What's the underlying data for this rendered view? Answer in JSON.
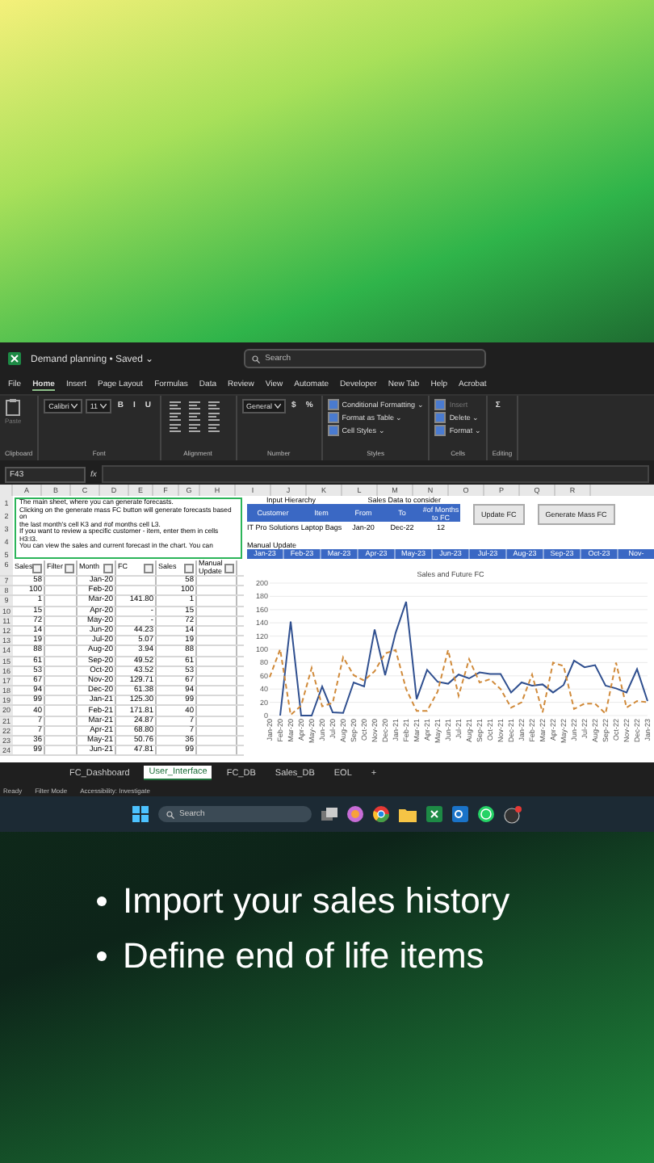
{
  "titlebar": {
    "title": "Demand planning • Saved ⌄",
    "search": {
      "placeholder": "Search"
    }
  },
  "menu": [
    {
      "label": "File",
      "selected": false
    },
    {
      "label": "Home",
      "selected": true
    },
    {
      "label": "Insert",
      "selected": false
    },
    {
      "label": "Page Layout",
      "selected": false
    },
    {
      "label": "Formulas",
      "selected": false
    },
    {
      "label": "Data",
      "selected": false
    },
    {
      "label": "Review",
      "selected": false
    },
    {
      "label": "View",
      "selected": false
    },
    {
      "label": "Automate",
      "selected": false
    },
    {
      "label": "Developer",
      "selected": false
    },
    {
      "label": "New Tab",
      "selected": false
    },
    {
      "label": "Help",
      "selected": false
    },
    {
      "label": "Acrobat",
      "selected": false
    }
  ],
  "ribbon": [
    {
      "label": "Clipboard",
      "items": [
        {
          "kind": "paste",
          "text": "Paste",
          "disabled": true
        }
      ]
    },
    {
      "label": "Font",
      "items": [
        {
          "kind": "field",
          "text": "Calibri"
        },
        {
          "kind": "field",
          "text": "11"
        },
        {
          "kind": "glyph",
          "text": "B"
        },
        {
          "kind": "glyph",
          "text": "I"
        },
        {
          "kind": "glyph",
          "text": "U"
        }
      ]
    },
    {
      "label": "Alignment",
      "items": [
        {
          "kind": "align"
        }
      ]
    },
    {
      "label": "Number",
      "items": [
        {
          "kind": "field",
          "text": "General"
        },
        {
          "kind": "glyph",
          "text": "$"
        },
        {
          "kind": "glyph",
          "text": "%"
        }
      ]
    },
    {
      "label": "Styles",
      "items": [
        {
          "kind": "row",
          "text": "Conditional Formatting ⌄",
          "disabled": false
        },
        {
          "kind": "row",
          "text": "Format as Table ⌄",
          "disabled": false
        },
        {
          "kind": "row",
          "text": "Cell Styles ⌄",
          "disabled": false
        }
      ]
    },
    {
      "label": "Cells",
      "items": [
        {
          "kind": "row",
          "text": "Insert",
          "disabled": true
        },
        {
          "kind": "row",
          "text": "Delete ⌄",
          "disabled": false
        },
        {
          "kind": "row",
          "text": "Format ⌄",
          "disabled": false
        }
      ]
    },
    {
      "label": "Editing",
      "items": [
        {
          "kind": "glyph",
          "text": "Σ"
        }
      ]
    }
  ],
  "formula_bar": {
    "name_box": "F43",
    "fx": "fx"
  },
  "columns": [
    "A",
    "B",
    "C",
    "D",
    "E",
    "F",
    "G",
    "H",
    "I",
    "J",
    "K",
    "L",
    "M",
    "N",
    "O",
    "P",
    "Q",
    "R"
  ],
  "note": {
    "lines": [
      "The main sheet, where you can generate forecasts.",
      "Clicking on the generate mass FC button will generate forecasts based on",
      "the last month's cell K3 and #of months cell L3.",
      "If you want to review a specific customer - item, enter them in cells H3:I3.",
      "You can view the sales and current forecast in the chart. You can"
    ],
    "row_numbers": [
      "1",
      "2",
      "3",
      "4",
      "5"
    ]
  },
  "table": {
    "header_row": "6",
    "headers": [
      "Sales",
      "Filter",
      "Month",
      "FC",
      "Sales",
      "Manual Update"
    ],
    "rows": [
      {
        "row": "7",
        "sales": "58",
        "month": "Jan-20",
        "fc": "",
        "sales2": "58"
      },
      {
        "row": "8",
        "sales": "100",
        "month": "Feb-20",
        "fc": "",
        "sales2": "100"
      },
      {
        "row": "9",
        "sales": "1",
        "month": "Mar-20",
        "fc": "141.80",
        "sales2": "1"
      },
      {
        "row": "10",
        "sales": "15",
        "month": "Apr-20",
        "fc": "-",
        "sales2": "15"
      },
      {
        "row": "11",
        "sales": "72",
        "month": "May-20",
        "fc": "-",
        "sales2": "72"
      },
      {
        "row": "12",
        "sales": "14",
        "month": "Jun-20",
        "fc": "44.23",
        "sales2": "14"
      },
      {
        "row": "13",
        "sales": "19",
        "month": "Jul-20",
        "fc": "5.07",
        "sales2": "19"
      },
      {
        "row": "14",
        "sales": "88",
        "month": "Aug-20",
        "fc": "3.94",
        "sales2": "88"
      },
      {
        "row": "15",
        "sales": "61",
        "month": "Sep-20",
        "fc": "49.52",
        "sales2": "61"
      },
      {
        "row": "16",
        "sales": "53",
        "month": "Oct-20",
        "fc": "43.52",
        "sales2": "53"
      },
      {
        "row": "17",
        "sales": "67",
        "month": "Nov-20",
        "fc": "129.71",
        "sales2": "67"
      },
      {
        "row": "18",
        "sales": "94",
        "month": "Dec-20",
        "fc": "61.38",
        "sales2": "94"
      },
      {
        "row": "19",
        "sales": "99",
        "month": "Jan-21",
        "fc": "125.30",
        "sales2": "99"
      },
      {
        "row": "20",
        "sales": "40",
        "month": "Feb-21",
        "fc": "171.81",
        "sales2": "40"
      },
      {
        "row": "21",
        "sales": "7",
        "month": "Mar-21",
        "fc": "24.87",
        "sales2": "7"
      },
      {
        "row": "22",
        "sales": "7",
        "month": "Apr-21",
        "fc": "68.80",
        "sales2": "7"
      },
      {
        "row": "23",
        "sales": "36",
        "month": "May-21",
        "fc": "50.76",
        "sales2": "36"
      },
      {
        "row": "24",
        "sales": "99",
        "month": "Jun-21",
        "fc": "47.81",
        "sales2": "99"
      }
    ]
  },
  "inputs": {
    "title_left": "Input Hierarchy",
    "title_right": "Sales Data to consider",
    "headers": [
      "Customer",
      "Item",
      "From",
      "To",
      "#of Months to FC"
    ],
    "values": [
      "IT Pro Solutions",
      "Laptop Bags",
      "Jan-20",
      "Dec-22",
      "12"
    ],
    "buttons": [
      "Update FC",
      "Generate Mass FC"
    ],
    "manual_label": "Manual Update",
    "months": [
      "Jan-23",
      "Feb-23",
      "Mar-23",
      "Apr-23",
      "May-23",
      "Jun-23",
      "Jul-23",
      "Aug-23",
      "Sep-23",
      "Oct-23",
      "Nov-"
    ]
  },
  "chart_data": {
    "type": "line",
    "title": "Sales and Future FC",
    "grid": true,
    "categories": [
      "Jan-20",
      "Feb-20",
      "Mar-20",
      "Apr-20",
      "May-20",
      "Jun-20",
      "Jul-20",
      "Aug-20",
      "Sep-20",
      "Oct-20",
      "Nov-20",
      "Dec-20",
      "Jan-21",
      "Feb-21",
      "Mar-21",
      "Apr-21",
      "May-21",
      "Jun-21",
      "Jul-21",
      "Aug-21",
      "Sep-21",
      "Oct-21",
      "Nov-21",
      "Dec-21",
      "Jan-22",
      "Feb-22",
      "Mar-22",
      "Apr-22",
      "May-22",
      "Jun-22",
      "Jul-22",
      "Aug-22",
      "Sep-22",
      "Oct-22",
      "Nov-22",
      "Dec-22",
      "Jan-23"
    ],
    "ylim": [
      0,
      200
    ],
    "yticks": [
      0,
      20,
      40,
      60,
      80,
      100,
      120,
      140,
      160,
      180,
      200
    ],
    "series": [
      {
        "color": "#2f4f8f",
        "line_style": "solid",
        "values": [
          null,
          0,
          142,
          0,
          0,
          44,
          5,
          4,
          50,
          44,
          130,
          61,
          125,
          172,
          25,
          69,
          51,
          48,
          62,
          56,
          65,
          63,
          63,
          35,
          50,
          45,
          47,
          35,
          46,
          83,
          73,
          76,
          45,
          41,
          35,
          70,
          22
        ]
      },
      {
        "color": "#d08a3a",
        "line_style": "dashed",
        "values": [
          58,
          100,
          1,
          15,
          72,
          14,
          19,
          88,
          61,
          53,
          67,
          94,
          99,
          40,
          7,
          7,
          36,
          99,
          30,
          85,
          50,
          55,
          40,
          12,
          20,
          62,
          5,
          80,
          75,
          10,
          18,
          18,
          3,
          80,
          12,
          22,
          20
        ]
      }
    ]
  },
  "sheet_tabs": [
    {
      "label": "FC_Dashboard",
      "selected": false
    },
    {
      "label": "User_Interface",
      "selected": true
    },
    {
      "label": "FC_DB",
      "selected": false
    },
    {
      "label": "Sales_DB",
      "selected": false
    },
    {
      "label": "EOL",
      "selected": false
    }
  ],
  "add_sheet": "+",
  "status_bar": [
    "Ready",
    "Filter Mode",
    "Accessibility: Investigate"
  ],
  "taskbar": {
    "search": {
      "placeholder": "Search"
    }
  },
  "bullets": [
    "Import your sales history",
    "Define end of life items"
  ]
}
